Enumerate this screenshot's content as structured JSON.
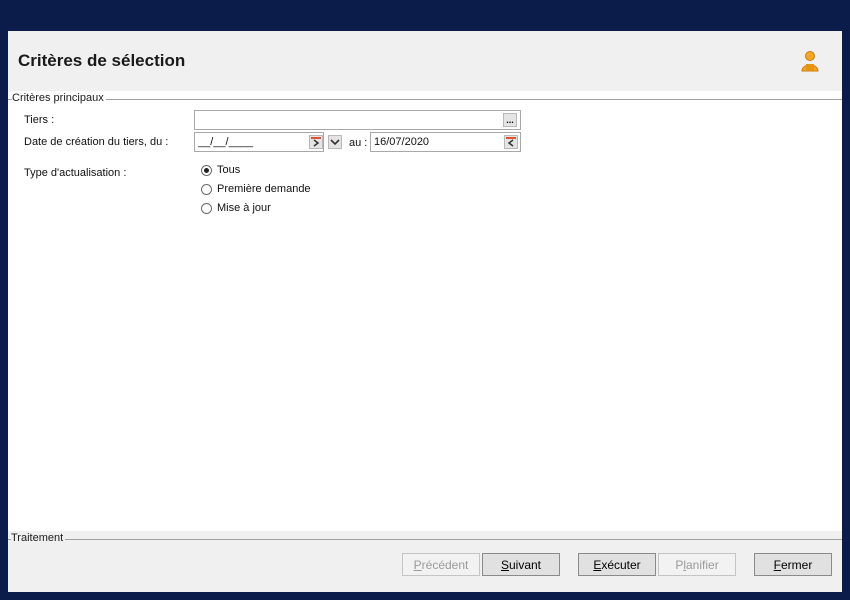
{
  "header": {
    "title": "Critères de sélection"
  },
  "criteria": {
    "group_label": "Critères principaux",
    "tiers_label": "Tiers :",
    "tiers_value": "",
    "tiers_button": "...",
    "date_label": "Date de création du tiers, du :",
    "date_from_value": "__/__/____",
    "date_to_label": "au :",
    "date_to_value": "16/07/2020",
    "type_label": "Type d'actualisation :",
    "options": [
      {
        "label": "Tous",
        "checked": true
      },
      {
        "label": "Première demande",
        "checked": false
      },
      {
        "label": "Mise à jour",
        "checked": false
      }
    ]
  },
  "footer": {
    "group_label": "Traitement",
    "buttons": {
      "precedent": {
        "u": "P",
        "rest": "récédent"
      },
      "suivant": {
        "u": "S",
        "rest": "uivant"
      },
      "executer": {
        "u": "E",
        "rest": "xécuter"
      },
      "planifier_pre": "P",
      "planifier_u": "l",
      "planifier_rest": "anifier",
      "fermer": {
        "u": "F",
        "rest": "ermer"
      }
    }
  }
}
